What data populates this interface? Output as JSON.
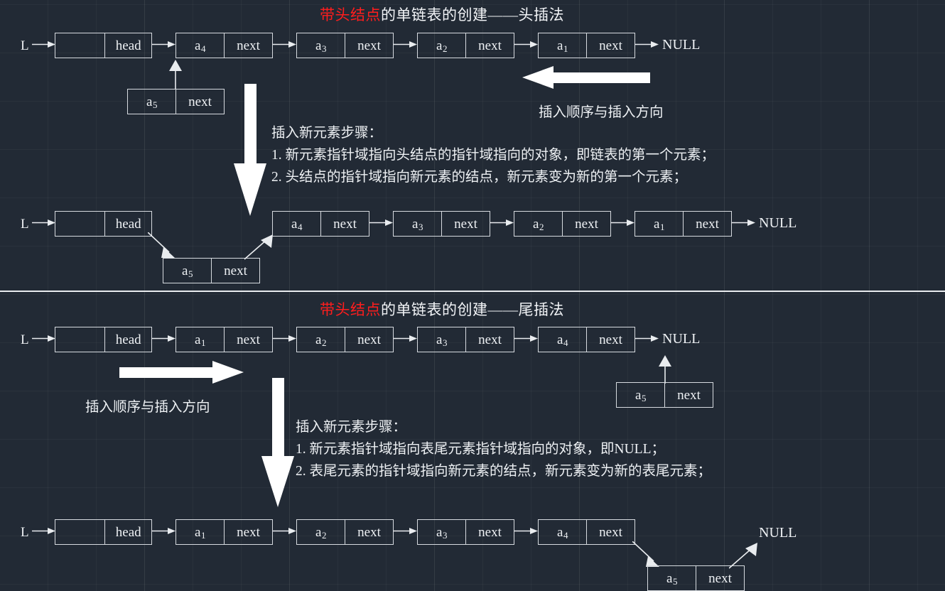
{
  "page": {
    "background_color": "#222a35",
    "line_color": "#e9ecef",
    "highlight_color": "#ff1d1d"
  },
  "section1": {
    "title_highlight": "带头结点",
    "title_rest": "的单链表的创建——头插法",
    "row1": {
      "pointer_label": "L",
      "head_node": {
        "data": "",
        "ptr": "head"
      },
      "nodes": [
        {
          "data": "a",
          "sub": "4",
          "ptr": "next"
        },
        {
          "data": "a",
          "sub": "3",
          "ptr": "next"
        },
        {
          "data": "a",
          "sub": "2",
          "ptr": "next"
        },
        {
          "data": "a",
          "sub": "1",
          "ptr": "next"
        }
      ],
      "tail_label": "NULL"
    },
    "new_node": {
      "data": "a",
      "sub": "5",
      "ptr": "next"
    },
    "direction_caption": "插入顺序与插入方向",
    "steps": {
      "heading": "插入新元素步骤：",
      "items": [
        "1. 新元素指针域指向头结点的指针域指向的对象，即链表的第一个元素；",
        "2. 头结点的指针域指向新元素的结点，新元素变为新的第一个元素；"
      ]
    },
    "row2": {
      "pointer_label": "L",
      "head_node": {
        "data": "",
        "ptr": "head"
      },
      "nodes": [
        {
          "data": "a",
          "sub": "4",
          "ptr": "next"
        },
        {
          "data": "a",
          "sub": "3",
          "ptr": "next"
        },
        {
          "data": "a",
          "sub": "2",
          "ptr": "next"
        },
        {
          "data": "a",
          "sub": "1",
          "ptr": "next"
        }
      ],
      "tail_label": "NULL",
      "inserted_node": {
        "data": "a",
        "sub": "5",
        "ptr": "next"
      }
    }
  },
  "section2": {
    "title_highlight": "带头结点",
    "title_rest": "的单链表的创建——尾插法",
    "row1": {
      "pointer_label": "L",
      "head_node": {
        "data": "",
        "ptr": "head"
      },
      "nodes": [
        {
          "data": "a",
          "sub": "1",
          "ptr": "next"
        },
        {
          "data": "a",
          "sub": "2",
          "ptr": "next"
        },
        {
          "data": "a",
          "sub": "3",
          "ptr": "next"
        },
        {
          "data": "a",
          "sub": "4",
          "ptr": "next"
        }
      ],
      "tail_label": "NULL"
    },
    "new_node": {
      "data": "a",
      "sub": "5",
      "ptr": "next"
    },
    "direction_caption": "插入顺序与插入方向",
    "steps": {
      "heading": "插入新元素步骤：",
      "items": [
        "1. 新元素指针域指向表尾元素指针域指向的对象，即NULL；",
        "2. 表尾元素的指针域指向新元素的结点，新元素变为新的表尾元素；"
      ]
    },
    "row2": {
      "pointer_label": "L",
      "head_node": {
        "data": "",
        "ptr": "head"
      },
      "nodes": [
        {
          "data": "a",
          "sub": "1",
          "ptr": "next"
        },
        {
          "data": "a",
          "sub": "2",
          "ptr": "next"
        },
        {
          "data": "a",
          "sub": "3",
          "ptr": "next"
        },
        {
          "data": "a",
          "sub": "4",
          "ptr": "next"
        }
      ],
      "tail_label": "NULL",
      "inserted_node": {
        "data": "a",
        "sub": "5",
        "ptr": "next"
      }
    }
  }
}
